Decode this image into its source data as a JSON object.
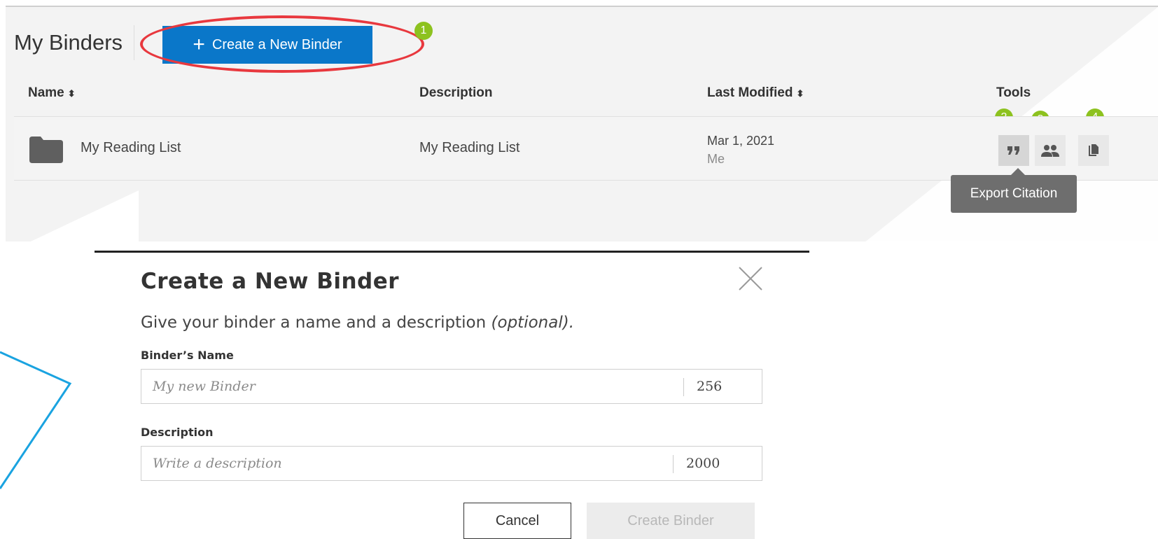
{
  "header": {
    "title": "My Binders",
    "create_button_label": "Create a New Binder",
    "create_button_icon": "plus-icon"
  },
  "annotations": {
    "badges": [
      "1",
      "2",
      "3",
      "4"
    ],
    "highlight_color": "#e8383e",
    "badge_color": "#8dc21f",
    "pointer_line_color": "#1aa3e0"
  },
  "table": {
    "columns": [
      {
        "label": "Name",
        "sortable": true
      },
      {
        "label": "Description",
        "sortable": false
      },
      {
        "label": "Last Modified",
        "sortable": true
      },
      {
        "label": "Tools",
        "sortable": false
      }
    ],
    "rows": [
      {
        "icon": "folder-icon",
        "name": "My Reading List",
        "description": "My Reading List",
        "modified_date": "Mar 1, 2021",
        "modified_by": "Me",
        "tools": [
          "quote-icon",
          "share-users-icon",
          "copy-icon"
        ]
      }
    ]
  },
  "tooltip": {
    "text": "Export Citation"
  },
  "dialog": {
    "title": "Create a New Binder",
    "subtitle_main": "Give your binder a name and a description ",
    "subtitle_optional": "(optional).",
    "name_label": "Binder’s Name",
    "name_placeholder": "My new Binder",
    "name_counter": "256",
    "description_label": "Description",
    "description_placeholder": "Write a description",
    "description_counter": "2000",
    "cancel_label": "Cancel",
    "submit_label": "Create Binder"
  },
  "colors": {
    "primary_button": "#0a77c9",
    "tooltip_bg": "#6e6e6e"
  }
}
